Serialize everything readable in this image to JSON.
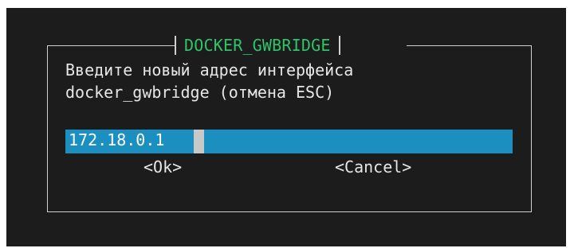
{
  "dialog": {
    "title": "DOCKER_GWBRIDGE",
    "prompt_line1": "Введите новый адрес интерфейса",
    "prompt_line2": "docker_gwbridge (отмена ESC)",
    "input_value": "172.18.0.1",
    "ok_label": "<Ok>",
    "cancel_label": "<Cancel>"
  },
  "colors": {
    "background": "#1c1c1c",
    "title": "#2ec46a",
    "input_field": "#1b8fc0",
    "frame": "#cfcfcf"
  }
}
